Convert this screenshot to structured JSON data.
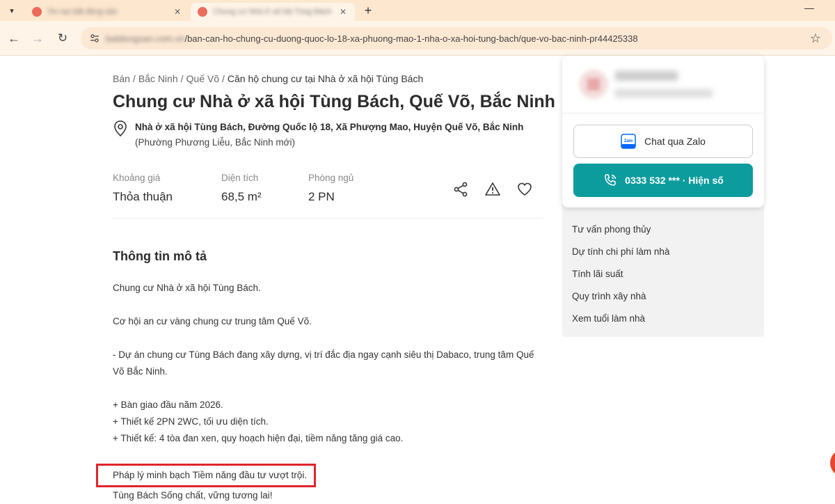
{
  "browser": {
    "tabs": [
      {
        "title": "Tin rao bất động sản",
        "active": false
      },
      {
        "title": "Chung cư Nhà ở xã hội Tùng Bách",
        "active": true
      }
    ],
    "new_tab_label": "+",
    "url_host": "batdongsan.com.vn",
    "url_path": "/ban-can-ho-chung-cu-duong-quoc-lo-18-xa-phuong-mao-1-nha-o-xa-hoi-tung-bach/que-vo-bac-ninh-pr44425338"
  },
  "breadcrumb": {
    "items": [
      "Bán",
      "Bắc Ninh",
      "Quế Võ"
    ],
    "separator": "/",
    "current": "Căn hộ chung cư tại Nhà ở xã hội Tùng Bách"
  },
  "listing": {
    "title": "Chung cư Nhà ở xã hội Tùng Bách, Quế Võ, Bắc Ninh",
    "address_line1": "Nhà ở xã hội Tùng Bách, Đường Quốc lộ 18, Xã Phượng Mao, Huyện Quế Võ, Bắc Ninh",
    "address_line2": "(Phường Phương Liễu, Bắc Ninh mới)"
  },
  "stats": [
    {
      "label": "Khoảng giá",
      "value": "Thỏa thuận"
    },
    {
      "label": "Diện tích",
      "value": "68,5 m²"
    },
    {
      "label": "Phòng ngủ",
      "value": "2 PN"
    }
  ],
  "description": {
    "heading": "Thông tin mô tả",
    "paragraphs": [
      "Chung cư Nhà ở xã hội Tùng Bách.",
      "",
      "Cơ hội an cư vàng chung cư trung tâm Quế Võ.",
      "",
      "- Dự án chung cư Tùng Bách đang xây dựng, vị trí đắc địa ngay cạnh siêu thị Dabaco, trung tâm Quế Võ Bắc Ninh.",
      "",
      "+ Bàn giao đầu năm 2026.",
      "+ Thiết kế 2PN 2WC, tối ưu diện tích.",
      "+ Thiết kế: 4 tòa đan xen, quy hoạch hiện đại, tiềm năng tăng giá cao.",
      "",
      "Pháp lý minh bạch Tiềm năng đầu tư vượt trội.",
      "Tùng Bách Sống chất, vững tương lai!"
    ],
    "highlighted_index": 10
  },
  "contact": {
    "zalo_label": "Chat qua Zalo",
    "phone_label": "0333 532 *** · Hiện số"
  },
  "sidebar_menu": [
    "Tư vấn phong thủy",
    "Dự tính chi phí làm nhà",
    "Tính lãi suất",
    "Quy trình xây nhà",
    "Xem tuổi làm nhà"
  ],
  "colors": {
    "accent": "#0d9c9e",
    "highlight_border": "#e0242b",
    "chrome_bg": "#fde7cf"
  }
}
